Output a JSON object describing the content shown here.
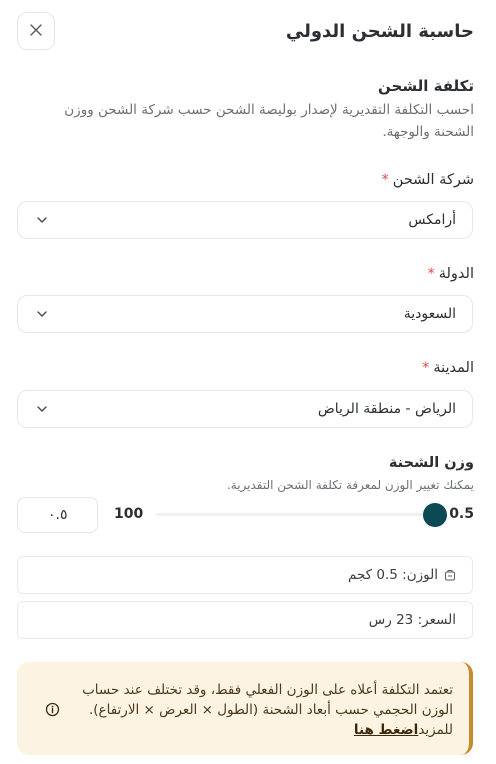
{
  "header": {
    "title": "حاسبة الشحن الدولي"
  },
  "section": {
    "title": "تكلفة الشحن",
    "description": "احسب التكلفة التقديرية لإصدار بوليصة الشحن حسب شركة الشحن ووزن الشحنة والوجهة."
  },
  "fields": {
    "carrier": {
      "label": "شركة الشحن",
      "required_mark": "*",
      "value": "أرامكس"
    },
    "country": {
      "label": "الدولة",
      "required_mark": "*",
      "value": "السعودية"
    },
    "city": {
      "label": "المدينة",
      "required_mark": "*",
      "value": "الرياض - منطقة الرياض"
    }
  },
  "weight": {
    "label": "وزن الشحنة",
    "hint": "يمكنك تغيير الوزن لمعرفة تكلفة الشحن التقديرية.",
    "input_value": "٠.٥",
    "current_value": "0.5",
    "max_value": "100",
    "fraction": 0.005
  },
  "summary": {
    "weight_text": "الوزن: 0.5 كجم",
    "price_text": "السعر: 23 رس"
  },
  "notice": {
    "text": "تعتمد التكلفة أعلاه على الوزن الفعلي فقط، وقد تختلف عند حساب الوزن الحجمي حسب أبعاد الشحنة (الطول × العرض × الارتفاع). للمزيد",
    "link_label": "اضغط هنا"
  },
  "colors": {
    "accent": "#0b4a54",
    "required": "#e5484d",
    "notice_bg": "#fdf3e2",
    "notice_border": "#c98a2c"
  },
  "icons": {
    "close": "close-icon",
    "chevron": "chevron-down-icon",
    "weight": "weight-icon",
    "info": "info-icon"
  }
}
